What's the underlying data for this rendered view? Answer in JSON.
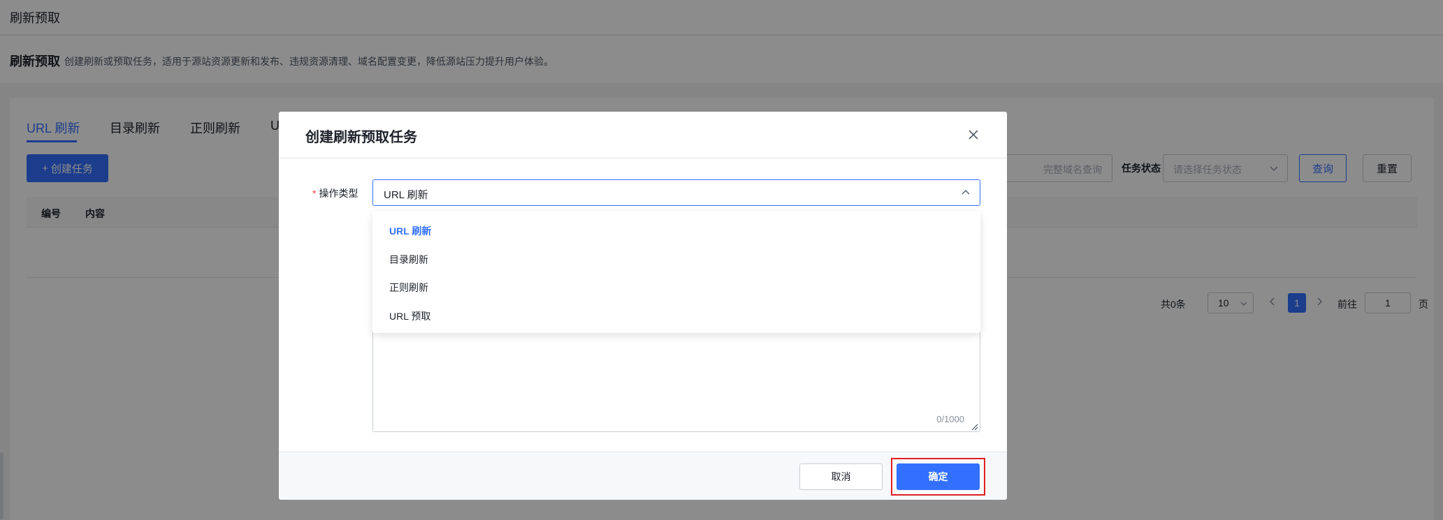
{
  "topbar": {
    "title": "刷新预取"
  },
  "header": {
    "title": "刷新预取",
    "description": "创建刷新或预取任务，适用于源站资源更新和发布、违规资源清理、域名配置变更，降低源站压力提升用户体验。"
  },
  "tabs": [
    {
      "label": "URL 刷新",
      "active": true
    },
    {
      "label": "目录刷新",
      "active": false
    },
    {
      "label": "正则刷新",
      "active": false
    },
    {
      "label": "U",
      "active": false
    }
  ],
  "toolbar": {
    "create_label": "创建任务",
    "domain_placeholder": "完整域名查询",
    "status_label": "任务状态",
    "status_placeholder": "请选择任务状态",
    "query_label": "查询",
    "reset_label": "重置"
  },
  "table": {
    "columns": [
      "编号",
      "内容"
    ]
  },
  "pagination": {
    "total_text": "共0条",
    "page_size": "10",
    "current_page": "1",
    "goto_label": "前往",
    "goto_value": "1",
    "page_suffix": "页"
  },
  "modal": {
    "title": "创建刷新预取任务",
    "field_label": "操作类型",
    "required_mark": "*",
    "selected_value": "URL 刷新",
    "counter": "0/1000",
    "cancel_label": "取消",
    "confirm_label": "确定"
  },
  "dropdown": {
    "options": [
      {
        "label": "URL 刷新",
        "selected": true
      },
      {
        "label": "目录刷新",
        "selected": false
      },
      {
        "label": "正则刷新",
        "selected": false
      },
      {
        "label": "URL 预取",
        "selected": false
      }
    ]
  },
  "colors": {
    "accent": "#3370ff",
    "highlight_outline": "#e02020",
    "required": "#f53f3f"
  }
}
